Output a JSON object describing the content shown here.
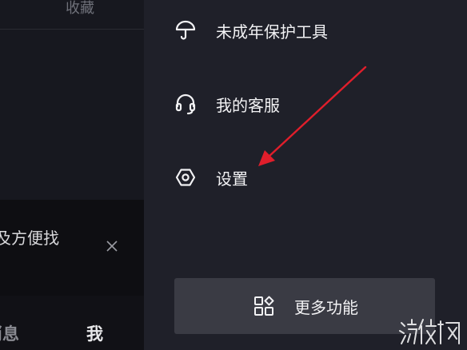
{
  "left_page": {
    "tab_collect": "收藏",
    "banner_text": "及方便找",
    "bottom_tabs": {
      "messages": "消息",
      "me": "我"
    }
  },
  "drawer": {
    "items": [
      {
        "label": "未成年保护工具",
        "icon": "umbrella-icon"
      },
      {
        "label": "我的客服",
        "icon": "headset-icon"
      },
      {
        "label": "设置",
        "icon": "hexagon-settings-icon"
      }
    ],
    "more_button": {
      "label": "更多功能",
      "icon": "apps-grid-icon"
    }
  },
  "annotation": {
    "arrow_color": "#e01e2b",
    "target": "设置"
  },
  "watermark": {
    "text": "游侠网"
  },
  "colors": {
    "background": "#1f2029",
    "text": "#f2f2f4",
    "button": "#3a3b44",
    "left_panel": "#17181f"
  }
}
